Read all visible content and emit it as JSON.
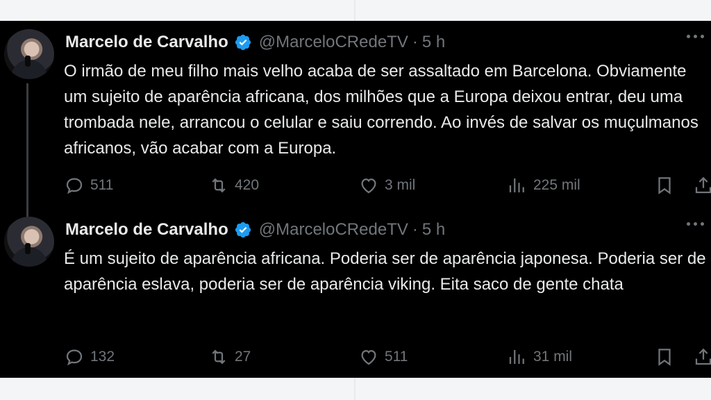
{
  "tweets": [
    {
      "author_name": "Marcelo de Carvalho",
      "handle": "@MarceloCRedeTV",
      "separator": "·",
      "time": "5 h",
      "text": "O irmão de meu filho mais velho acaba de ser assaltado em Barcelona. Obviamente um sujeito de aparência africana, dos milhões que a Europa deixou entrar, deu uma trombada nele, arrancou o celular e saiu correndo. Ao invés de salvar os muçulmanos africanos, vão acabar com a Europa.",
      "replies": "511",
      "retweets": "420",
      "likes": "3 mil",
      "views": "225 mil"
    },
    {
      "author_name": "Marcelo de Carvalho",
      "handle": "@MarceloCRedeTV",
      "separator": "·",
      "time": "5 h",
      "text": "É um sujeito de aparência africana. Poderia ser de aparência japonesa. Poderia ser de aparência eslava, poderia ser de aparência viking. Eita saco de gente chata",
      "replies": "132",
      "retweets": "27",
      "likes": "511",
      "views": "31 mil"
    }
  ],
  "colors": {
    "background": "#000000",
    "text_primary": "#e7e9ea",
    "text_secondary": "#71767b",
    "verified_badge": "#1d9bf0"
  },
  "icons": [
    "reply-icon",
    "retweet-icon",
    "like-icon",
    "views-icon",
    "bookmark-icon",
    "share-icon",
    "verified-badge-icon",
    "more-icon"
  ]
}
